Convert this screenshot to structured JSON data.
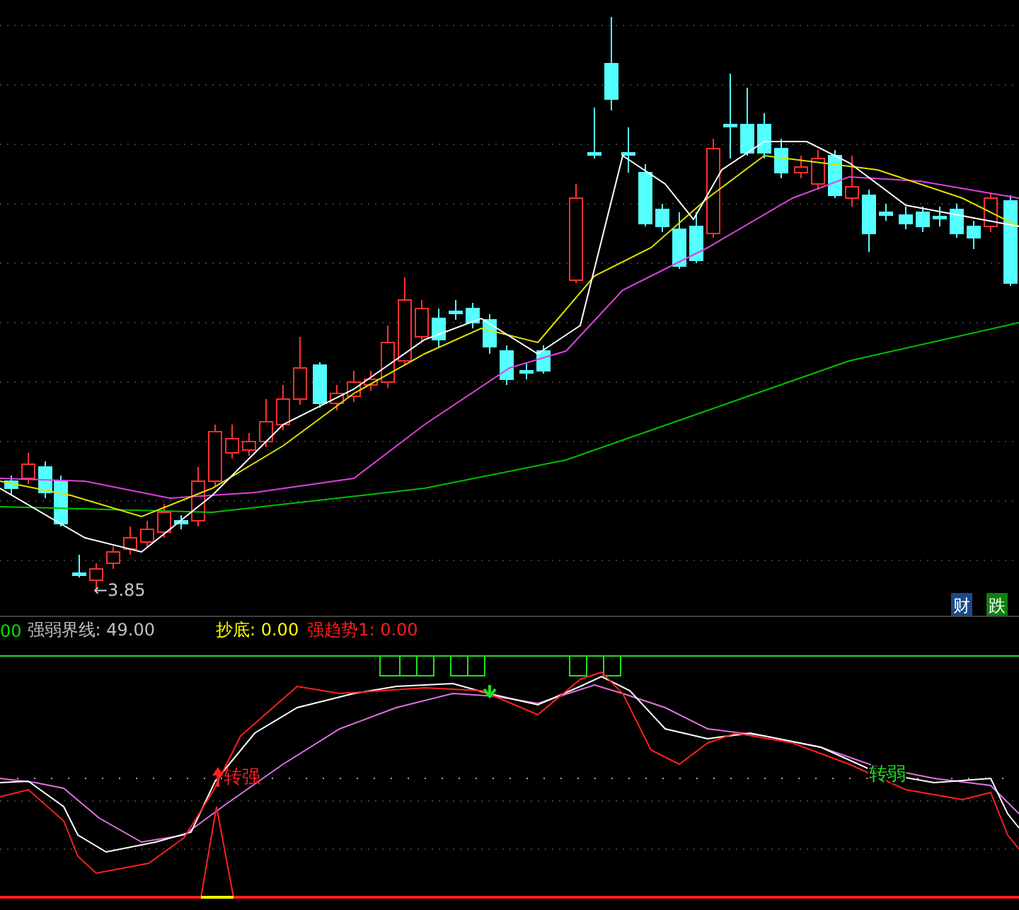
{
  "price_chart": {
    "low_label": "←3.85",
    "badges": [
      {
        "text": "财",
        "kind": "finance"
      },
      {
        "text": "跌",
        "kind": "fall"
      }
    ]
  },
  "indicator_bar": {
    "items": [
      {
        "text": "00",
        "color": "#00e000"
      },
      {
        "text": "强弱界线: 49.00",
        "color": "#c0c0c0"
      },
      {
        "text": "抄底: 0.00",
        "color": "#ffff00"
      },
      {
        "text": "强趋势1: 0.00",
        "color": "#ff2020"
      }
    ]
  },
  "indicator_chart": {
    "signals": [
      {
        "text": "转强",
        "kind": "up"
      },
      {
        "text": "转弱",
        "kind": "down"
      }
    ]
  }
}
